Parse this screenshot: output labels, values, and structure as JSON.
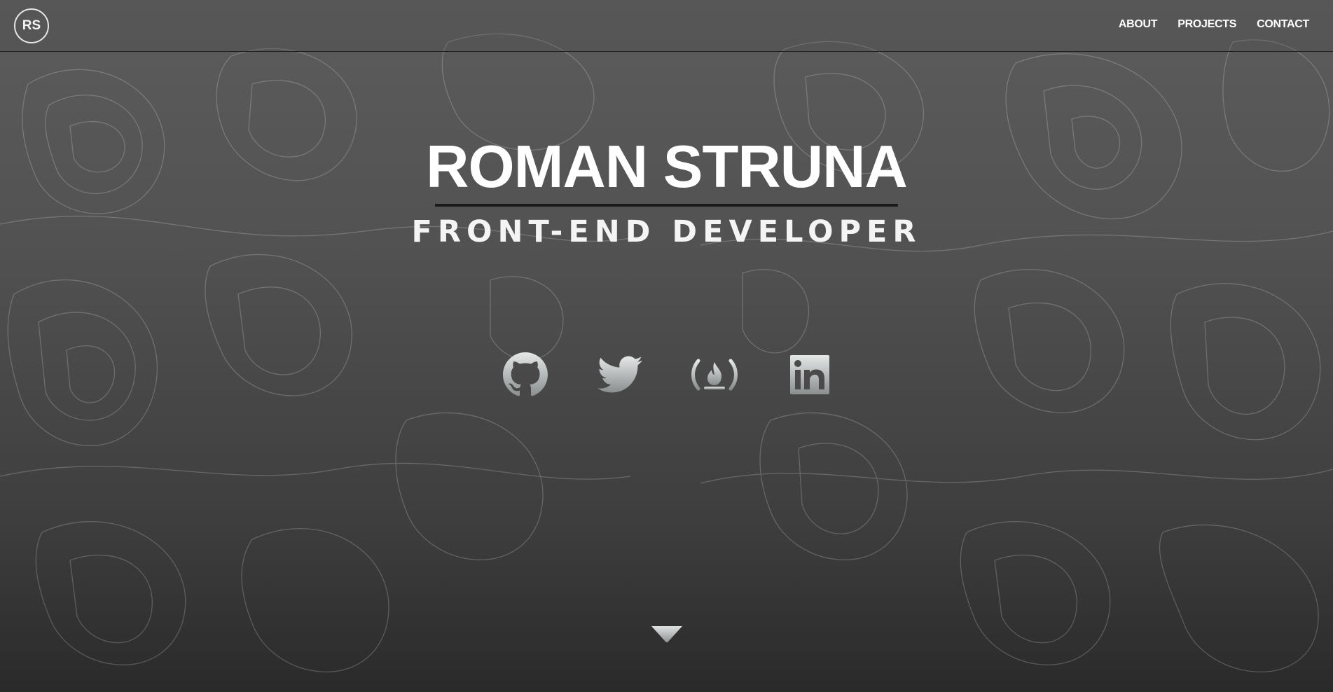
{
  "header": {
    "logo_text": "RS",
    "nav": [
      {
        "label": "ABOUT"
      },
      {
        "label": "PROJECTS"
      },
      {
        "label": "CONTACT"
      }
    ]
  },
  "hero": {
    "name": "ROMAN STRUNA",
    "title": "FRONT-END DEVELOPER"
  },
  "social_links": [
    {
      "icon": "github-icon"
    },
    {
      "icon": "twitter-icon"
    },
    {
      "icon": "freecodecamp-icon"
    },
    {
      "icon": "linkedin-icon"
    }
  ],
  "scroll_icon": "chevron-down-icon",
  "colors": {
    "background_top": "#5c5c5c",
    "background_bottom": "#2a2a2a",
    "divider": "#1b1b1b",
    "text": "#ffffff",
    "icon_light": "#d9dcdc",
    "icon_dark": "#8a8e8e"
  }
}
